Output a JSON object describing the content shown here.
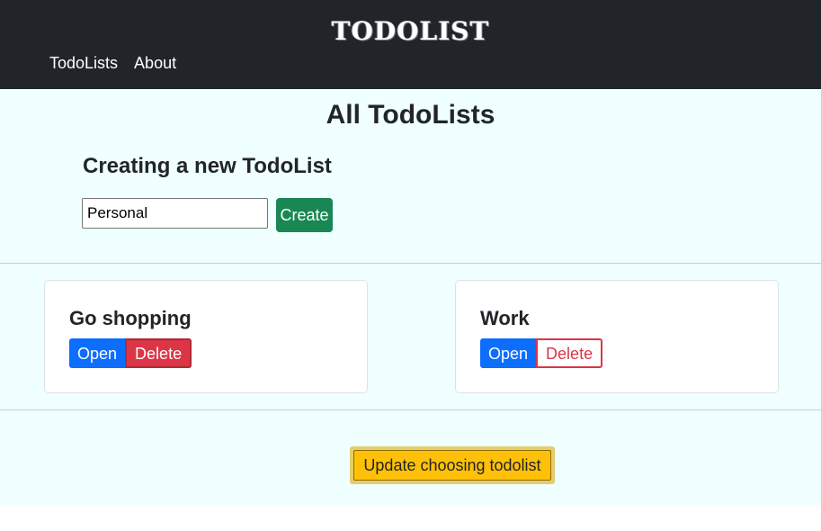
{
  "navbar": {
    "brand": "TODOLIST",
    "links": [
      {
        "label": "TodoLists"
      },
      {
        "label": "About"
      }
    ]
  },
  "main": {
    "title": "All TodoLists",
    "create": {
      "heading": "Creating a new TodoList",
      "input_value": "Personal",
      "button_label": "Create"
    },
    "todolists": [
      {
        "name": "Go shopping",
        "open_label": "Open",
        "delete_label": "Delete",
        "delete_style": "filled"
      },
      {
        "name": "Work",
        "open_label": "Open",
        "delete_label": "Delete",
        "delete_style": "outline"
      }
    ],
    "update_button_label": "Update choosing todolist"
  },
  "colors": {
    "navbar_bg": "#212529",
    "main_bg": "#f0ffff",
    "create": "#198754",
    "open": "#0d6efd",
    "delete": "#dc3545",
    "update": "#ffc107"
  }
}
